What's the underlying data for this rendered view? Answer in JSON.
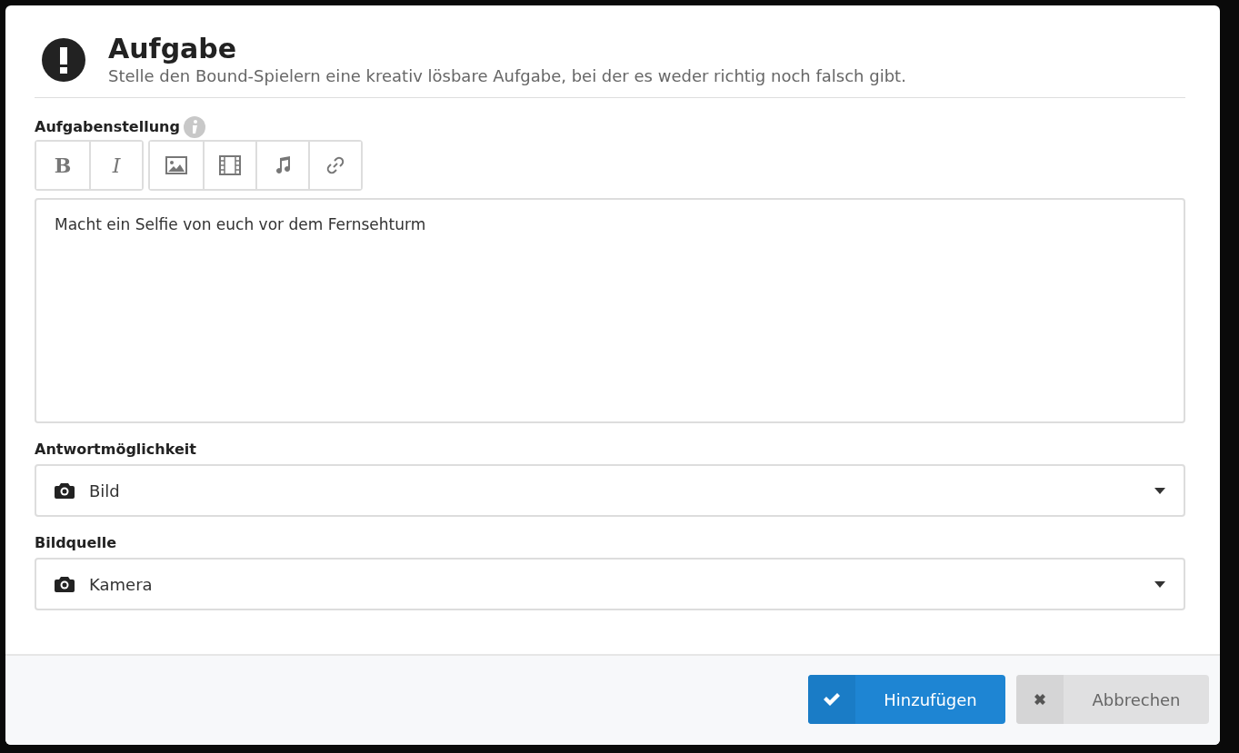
{
  "dialog": {
    "title": "Aufgabe",
    "subtitle": "Stelle den Bound-Spielern eine kreativ lösbare Aufgabe, bei der es weder richtig noch falsch gibt.",
    "fields": [
      {
        "kind": "editor",
        "label": "Aufgabenstellung",
        "toolbar": [
          [
            {
              "kind": "bold",
              "text": "B"
            },
            {
              "kind": "italic",
              "text": "I"
            }
          ],
          [
            {
              "kind": "image"
            },
            {
              "kind": "film"
            },
            {
              "kind": "music"
            },
            {
              "kind": "link"
            }
          ]
        ],
        "value": "Macht ein Selfie von euch vor dem Fernsehturm"
      },
      {
        "kind": "select",
        "label": "Antwortmöglichkeit",
        "value": "Bild"
      },
      {
        "kind": "select",
        "label": "Bildquelle",
        "value": "Kamera"
      }
    ],
    "buttons": [
      {
        "kind": "primary",
        "label": "Hinzufügen"
      },
      {
        "kind": "secondary",
        "label": "Abbrechen"
      }
    ]
  }
}
